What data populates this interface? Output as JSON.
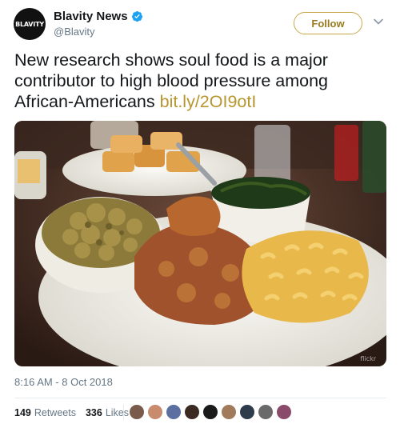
{
  "author": {
    "avatar_text": "BLAVITY",
    "display_name": "Blavity News",
    "handle": "@Blavity",
    "verified_icon": "verified-badge-icon"
  },
  "follow_label": "Follow",
  "menu_icon": "chevron-down-icon",
  "tweet": {
    "text": "New research shows soul food is a major contributor to high blood pressure among African-Americans ",
    "link": "bit.ly/2OI9otI"
  },
  "photo": {
    "watermark": "flickr"
  },
  "timestamp": "8:16 AM - 8 Oct 2018",
  "stats": {
    "retweets_count": "149",
    "retweets_label": "Retweets",
    "likes_count": "336",
    "likes_label": "Likes"
  },
  "liker_avatars": [
    "#7a5a4a",
    "#c98b6d",
    "#5b6fa0",
    "#3a2a22",
    "#1a1a1a",
    "#a07a5a",
    "#2d3b4a",
    "#6a6a6a",
    "#8a4a6a"
  ],
  "colors": {
    "accent": "#c9a84c",
    "link": "#b8952e",
    "muted": "#657786",
    "verified": "#1da1f2"
  }
}
